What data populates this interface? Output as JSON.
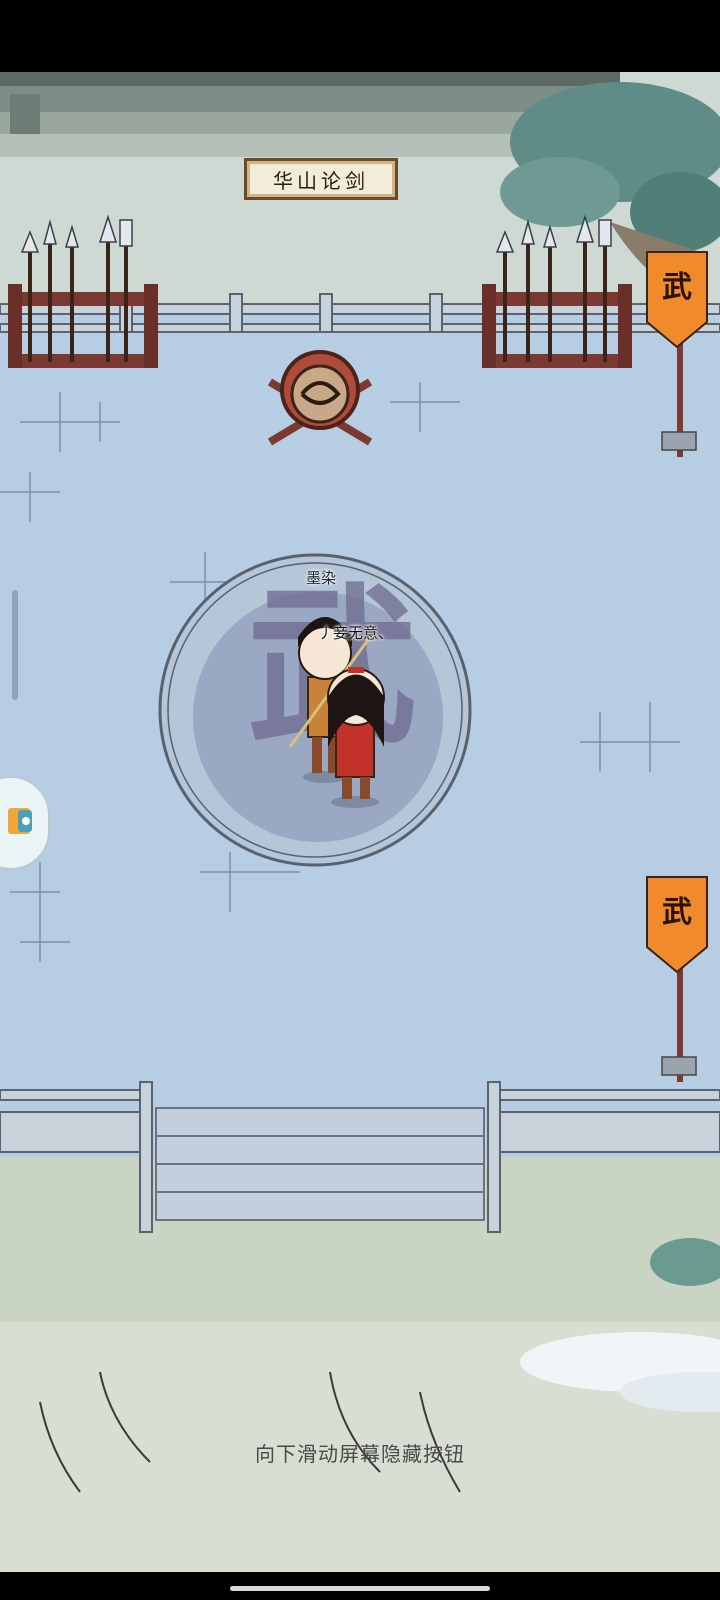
{
  "scene": {
    "sign_text": "华山论剑",
    "banner_char": "武",
    "center_char": "武"
  },
  "characters": [
    {
      "name": "墨染"
    },
    {
      "name": "丿妾无意、"
    }
  ],
  "hint": "向下滑动屏幕隐藏按钮",
  "side_button": {
    "icon": "game-center-icon"
  },
  "colors": {
    "floor": "#b6cce2",
    "banner": "#f08a2a",
    "wood": "#7a3a32",
    "grass": "#c7d3c0"
  }
}
